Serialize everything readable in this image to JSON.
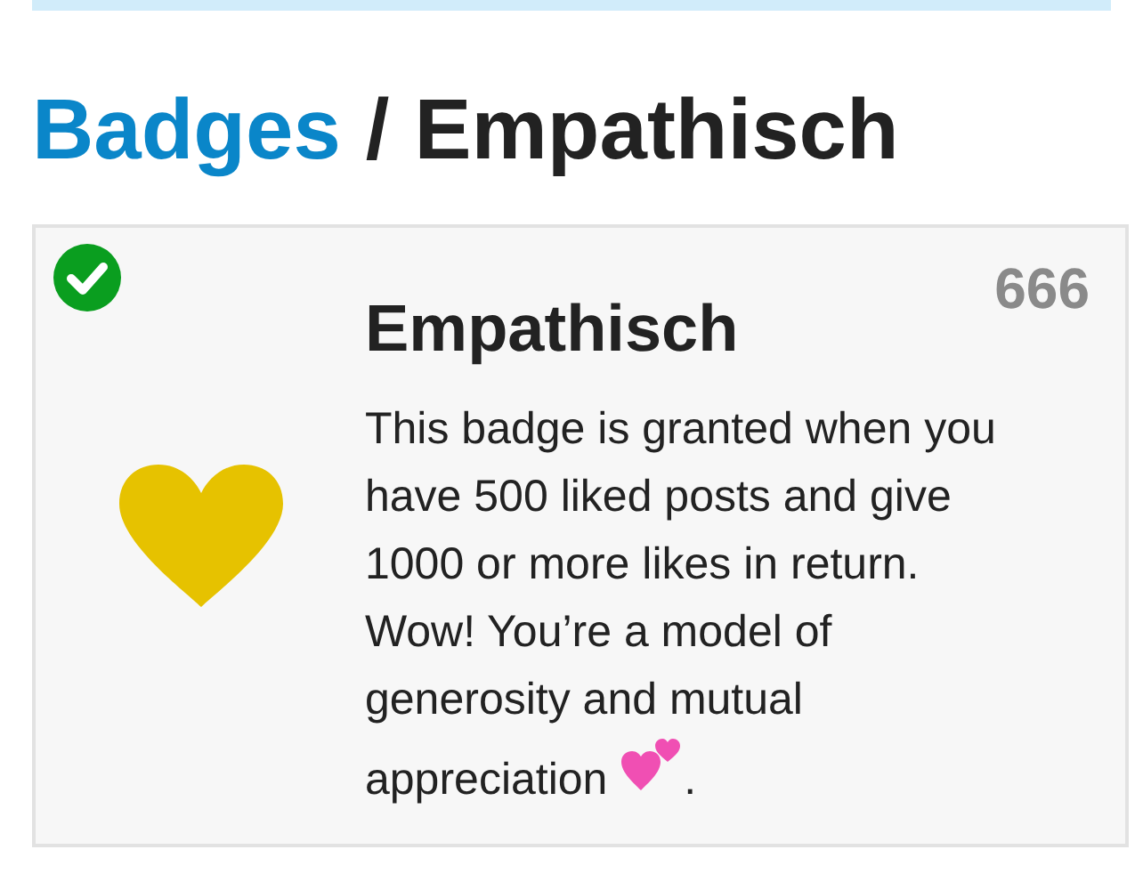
{
  "breadcrumb": {
    "parent": "Badges",
    "separator": "/",
    "current": "Empathisch"
  },
  "badge": {
    "earned": true,
    "title": "Empathisch",
    "count": "666",
    "description": "This badge is granted when you have 500 liked posts and give 1000 or more likes in return. Wow! You’re a model of generosity and mutual appreciation",
    "description_end": "."
  }
}
